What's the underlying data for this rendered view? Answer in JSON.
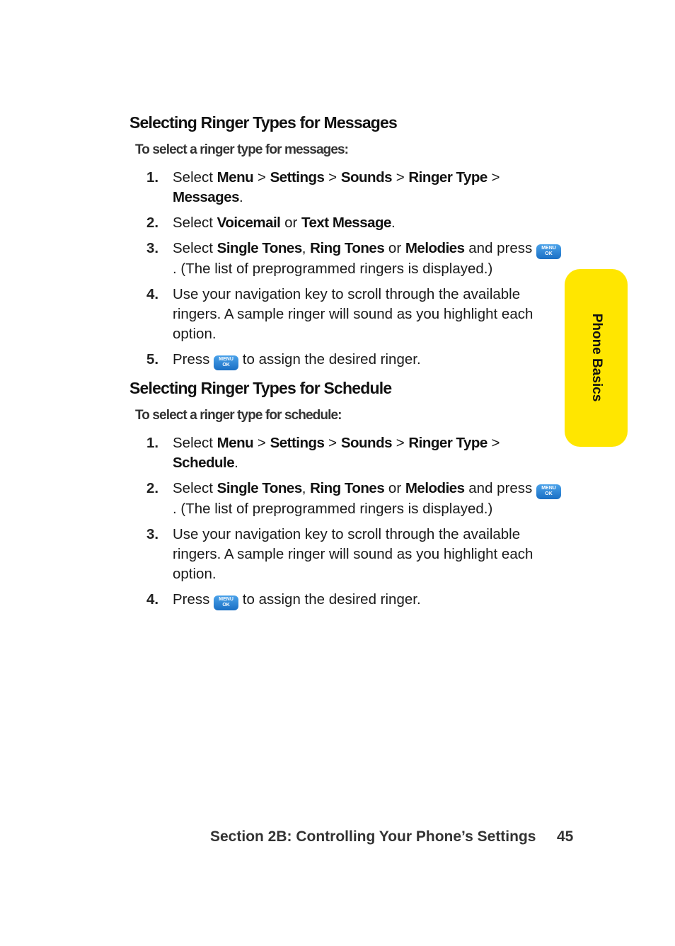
{
  "section1": {
    "heading": "Selecting Ringer Types for Messages",
    "lead": "To select a ringer type for messages:",
    "steps": [
      {
        "num": "1.",
        "parts": [
          [
            "t",
            "Select "
          ],
          [
            "b",
            "Menu"
          ],
          [
            "t",
            " > "
          ],
          [
            "b",
            "Settings"
          ],
          [
            "t",
            " > "
          ],
          [
            "b",
            "Sounds"
          ],
          [
            "t",
            " > "
          ],
          [
            "b",
            "Ringer Type"
          ],
          [
            "t",
            " > "
          ],
          [
            "b",
            "Messages"
          ],
          [
            "t",
            "."
          ]
        ]
      },
      {
        "num": "2.",
        "parts": [
          [
            "t",
            "Select "
          ],
          [
            "b",
            "Voicemail"
          ],
          [
            "t",
            " or "
          ],
          [
            "b",
            "Text Message"
          ],
          [
            "t",
            "."
          ]
        ]
      },
      {
        "num": "3.",
        "parts": [
          [
            "t",
            "Select "
          ],
          [
            "b",
            "Single Tones"
          ],
          [
            "t",
            ", "
          ],
          [
            "b",
            "Ring Tones"
          ],
          [
            "t",
            " or "
          ],
          [
            "b",
            "Melodies"
          ],
          [
            "t",
            " and press "
          ],
          [
            "k",
            "menu-ok-key"
          ],
          [
            "t",
            ". (The list of preprogrammed ringers is displayed.)"
          ]
        ]
      },
      {
        "num": "4.",
        "parts": [
          [
            "t",
            "Use your navigation key to scroll through the available ringers. A sample ringer will sound as you highlight each option."
          ]
        ]
      },
      {
        "num": "5.",
        "parts": [
          [
            "t",
            "Press "
          ],
          [
            "k",
            "menu-ok-key"
          ],
          [
            "t",
            " to assign the desired ringer."
          ]
        ]
      }
    ]
  },
  "section2": {
    "heading": "Selecting Ringer Types for Schedule",
    "lead": "To select a ringer type for schedule:",
    "steps": [
      {
        "num": "1.",
        "parts": [
          [
            "t",
            "Select "
          ],
          [
            "b",
            "Menu"
          ],
          [
            "t",
            " > "
          ],
          [
            "b",
            "Settings"
          ],
          [
            "t",
            " > "
          ],
          [
            "b",
            "Sounds"
          ],
          [
            "t",
            " > "
          ],
          [
            "b",
            "Ringer Type"
          ],
          [
            "t",
            " > "
          ],
          [
            "b",
            "Schedule"
          ],
          [
            "t",
            "."
          ]
        ]
      },
      {
        "num": "2.",
        "parts": [
          [
            "t",
            "Select "
          ],
          [
            "b",
            "Single Tones"
          ],
          [
            "t",
            ", "
          ],
          [
            "b",
            "Ring Tones"
          ],
          [
            "t",
            " or "
          ],
          [
            "b",
            "Melodies"
          ],
          [
            "t",
            " and press "
          ],
          [
            "k",
            "menu-ok-key"
          ],
          [
            "t",
            ". (The list of preprogrammed ringers is displayed.)"
          ]
        ]
      },
      {
        "num": "3.",
        "parts": [
          [
            "t",
            "Use your navigation key to scroll through the available ringers. A sample ringer will sound as you highlight each option."
          ]
        ]
      },
      {
        "num": "4.",
        "parts": [
          [
            "t",
            "Press "
          ],
          [
            "k",
            "menu-ok-key"
          ],
          [
            "t",
            " to assign the desired ringer."
          ]
        ]
      }
    ]
  },
  "key_icon": {
    "line1": "MENU",
    "line2": "OK",
    "color": "#2a82d6"
  },
  "side_tab": {
    "label": "Phone Basics",
    "color": "#ffe600"
  },
  "footer": {
    "section": "Section 2B: Controlling Your Phone’s Settings",
    "page": "45"
  }
}
